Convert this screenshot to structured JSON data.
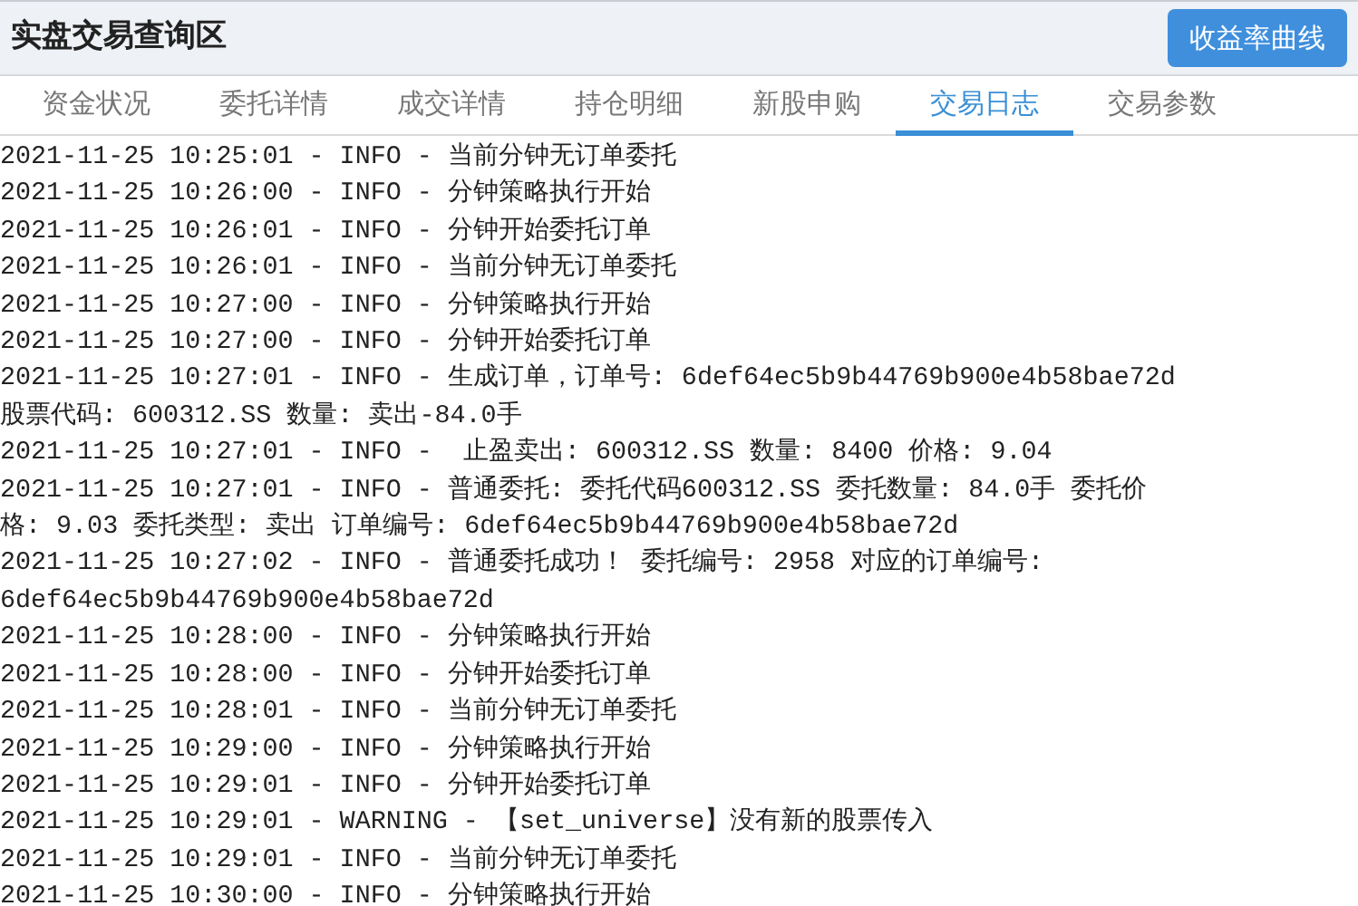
{
  "header": {
    "title": "实盘交易查询区",
    "button": "收益率曲线"
  },
  "tabs": [
    {
      "label": "资金状况",
      "selected": false
    },
    {
      "label": "委托详情",
      "selected": false
    },
    {
      "label": "成交详情",
      "selected": false
    },
    {
      "label": "持仓明细",
      "selected": false
    },
    {
      "label": "新股申购",
      "selected": false
    },
    {
      "label": "交易日志",
      "selected": true
    },
    {
      "label": "交易参数",
      "selected": false
    }
  ],
  "log_lines": [
    "2021-11-25 10:25:01 - INFO - 当前分钟无订单委托",
    "2021-11-25 10:26:00 - INFO - 分钟策略执行开始",
    "2021-11-25 10:26:01 - INFO - 分钟开始委托订单",
    "2021-11-25 10:26:01 - INFO - 当前分钟无订单委托",
    "2021-11-25 10:27:00 - INFO - 分钟策略执行开始",
    "2021-11-25 10:27:00 - INFO - 分钟开始委托订单",
    "2021-11-25 10:27:01 - INFO - 生成订单，订单号: 6def64ec5b9b44769b900e4b58bae72d",
    "股票代码: 600312.SS 数量: 卖出-84.0手",
    "2021-11-25 10:27:01 - INFO -  止盈卖出: 600312.SS 数量: 8400 价格: 9.04",
    "2021-11-25 10:27:01 - INFO - 普通委托: 委托代码600312.SS 委托数量: 84.0手 委托价",
    "格: 9.03 委托类型: 卖出 订单编号: 6def64ec5b9b44769b900e4b58bae72d",
    "2021-11-25 10:27:02 - INFO - 普通委托成功！ 委托编号: 2958 对应的订单编号:",
    "6def64ec5b9b44769b900e4b58bae72d",
    "2021-11-25 10:28:00 - INFO - 分钟策略执行开始",
    "2021-11-25 10:28:00 - INFO - 分钟开始委托订单",
    "2021-11-25 10:28:01 - INFO - 当前分钟无订单委托",
    "2021-11-25 10:29:00 - INFO - 分钟策略执行开始",
    "2021-11-25 10:29:01 - INFO - 分钟开始委托订单",
    "2021-11-25 10:29:01 - WARNING - 【set_universe】没有新的股票传入",
    "2021-11-25 10:29:01 - INFO - 当前分钟无订单委托",
    "2021-11-25 10:30:00 - INFO - 分钟策略执行开始"
  ]
}
